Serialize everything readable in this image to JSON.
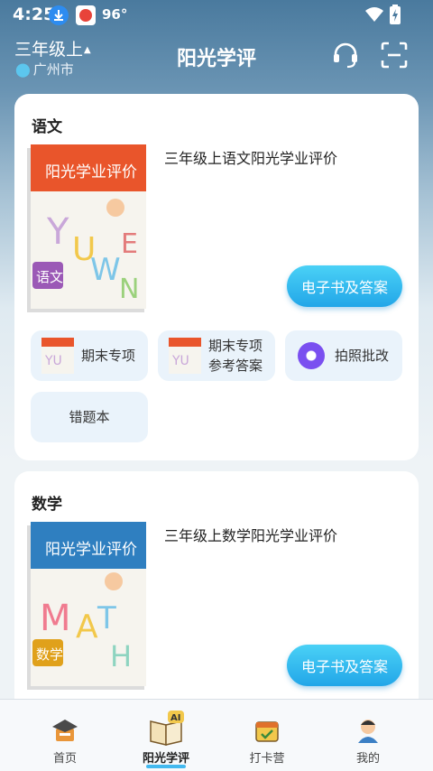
{
  "status": {
    "time": "4:25",
    "temperature": "96°"
  },
  "header": {
    "grade": "三年级上",
    "city": "广州市",
    "title": "阳光学评"
  },
  "cards": [
    {
      "subject": "语文",
      "book_title": "三年级上语文阳光学业评价",
      "ebook_label": "电子书及答案",
      "cover": {
        "header_text": "阳光学业评价",
        "letters": "YUWEN",
        "badge": "语文",
        "color": "#e9552b"
      },
      "tiles": [
        "期末专项",
        "期末专项\n参考答案",
        "拍照批改",
        "错题本"
      ]
    },
    {
      "subject": "数学",
      "book_title": "三年级上数学阳光学业评价",
      "ebook_label": "电子书及答案",
      "cover": {
        "header_text": "阳光学业评价",
        "letters": "MATH",
        "badge": "数学",
        "color": "#2f7fc0"
      }
    }
  ],
  "nav": [
    {
      "label": "首页",
      "icon": "home-hat-icon"
    },
    {
      "label": "阳光学评",
      "icon": "ai-book-icon",
      "active": true
    },
    {
      "label": "打卡营",
      "icon": "checkin-calendar-icon"
    },
    {
      "label": "我的",
      "icon": "user-avatar-icon"
    }
  ]
}
